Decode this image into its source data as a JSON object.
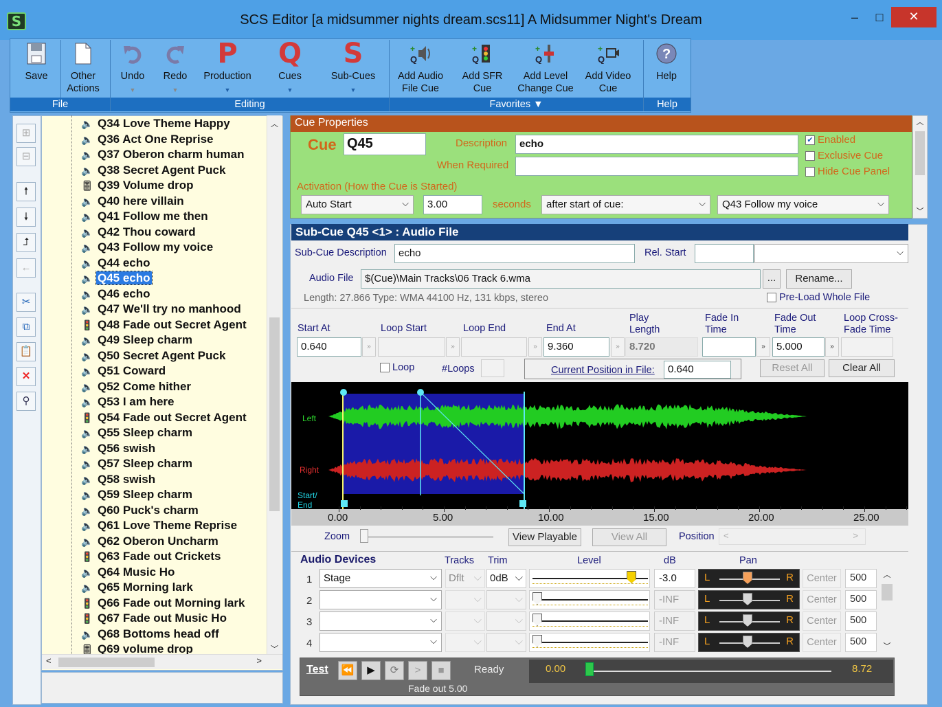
{
  "window": {
    "title": "SCS Editor  [a midsummer nights dream.scs11]  A Midsummer Night's Dream",
    "minimize": "–",
    "maximize": "□",
    "close": "✕"
  },
  "ribbon": {
    "buttons": [
      {
        "id": "save",
        "label": "Save",
        "icon": "save-icon"
      },
      {
        "id": "other",
        "label": "Other Actions",
        "icon": "document-icon"
      },
      {
        "id": "undo",
        "label": "Undo",
        "icon": "undo-icon"
      },
      {
        "id": "redo",
        "label": "Redo",
        "icon": "redo-icon"
      },
      {
        "id": "production",
        "label": "Production",
        "icon": "P"
      },
      {
        "id": "cues",
        "label": "Cues",
        "icon": "Q"
      },
      {
        "id": "subcues",
        "label": "Sub-Cues",
        "icon": "S"
      },
      {
        "id": "add_audio",
        "label": "Add Audio File Cue",
        "icon": "audio-cue-icon"
      },
      {
        "id": "add_sfr",
        "label": "Add SFR Cue",
        "icon": "sfr-cue-icon"
      },
      {
        "id": "add_level",
        "label": "Add Level Change Cue",
        "icon": "level-cue-icon"
      },
      {
        "id": "add_video",
        "label": "Add Video Cue",
        "icon": "video-cue-icon"
      },
      {
        "id": "help",
        "label": "Help",
        "icon": "help-icon"
      }
    ],
    "groups": {
      "file": "File",
      "editing": "Editing",
      "favorites": "Favorites ▼",
      "help": "Help"
    }
  },
  "tree": {
    "items": [
      {
        "label": "Q34 Love Theme Happy",
        "icon": "speaker"
      },
      {
        "label": "Q36 Act One Reprise",
        "icon": "speaker"
      },
      {
        "label": "Q37 Oberon charm human",
        "icon": "speaker"
      },
      {
        "label": "Q38 Secret Agent Puck",
        "icon": "speaker"
      },
      {
        "label": "Q39 Volume drop",
        "icon": "fader"
      },
      {
        "label": "Q40 here villain",
        "icon": "speaker"
      },
      {
        "label": "Q41 Follow me then",
        "icon": "speaker"
      },
      {
        "label": "Q42 Thou coward",
        "icon": "speaker"
      },
      {
        "label": "Q43 Follow my voice",
        "icon": "speaker"
      },
      {
        "label": "Q44 echo",
        "icon": "speaker"
      },
      {
        "label": "Q45 echo",
        "icon": "speaker",
        "selected": true
      },
      {
        "label": "Q46 echo",
        "icon": "speaker"
      },
      {
        "label": "Q47 We'll try no manhood",
        "icon": "speaker"
      },
      {
        "label": "Q48 Fade out Secret Agent",
        "icon": "traffic"
      },
      {
        "label": "Q49 Sleep charm",
        "icon": "speaker"
      },
      {
        "label": "Q50 Secret Agent Puck",
        "icon": "speaker"
      },
      {
        "label": "Q51 Coward",
        "icon": "speaker"
      },
      {
        "label": "Q52 Come hither",
        "icon": "speaker"
      },
      {
        "label": "Q53 I am here",
        "icon": "speaker"
      },
      {
        "label": "Q54 Fade out Secret Agent",
        "icon": "traffic"
      },
      {
        "label": "Q55 Sleep charm",
        "icon": "speaker"
      },
      {
        "label": "Q56 swish",
        "icon": "speaker"
      },
      {
        "label": "Q57 Sleep charm",
        "icon": "speaker"
      },
      {
        "label": "Q58 swish",
        "icon": "speaker"
      },
      {
        "label": "Q59 Sleep charm",
        "icon": "speaker"
      },
      {
        "label": "Q60 Puck's charm",
        "icon": "speaker"
      },
      {
        "label": "Q61 Love Theme Reprise",
        "icon": "speaker"
      },
      {
        "label": "Q62 Oberon Uncharm",
        "icon": "speaker"
      },
      {
        "label": "Q63 Fade out Crickets",
        "icon": "traffic"
      },
      {
        "label": "Q64 Music Ho",
        "icon": "speaker"
      },
      {
        "label": "Q65 Morning lark",
        "icon": "speaker"
      },
      {
        "label": "Q66 Fade out Morning lark",
        "icon": "traffic"
      },
      {
        "label": "Q67 Fade out Music Ho",
        "icon": "traffic"
      },
      {
        "label": "Q68 Bottoms head off",
        "icon": "speaker"
      },
      {
        "label": "Q69 volume drop",
        "icon": "fader"
      }
    ]
  },
  "cue_props": {
    "header": "Cue Properties",
    "cue_label": "Cue",
    "cue_value": "Q45",
    "desc_label": "Description",
    "desc_value": "echo",
    "when_label": "When Required",
    "when_value": "",
    "enabled": "Enabled",
    "exclusive": "Exclusive Cue",
    "hide": "Hide Cue Panel",
    "activation_label": "Activation (How the Cue is Started)",
    "activation_value": "Auto Start",
    "secs_value": "3.00",
    "seconds_label": "seconds",
    "after_value": "after start of cue:",
    "cue_ref_value": "Q43  Follow my voice"
  },
  "subcue": {
    "header": "Sub-Cue Q45 <1> : Audio File",
    "desc_label": "Sub-Cue Description",
    "desc_value": "echo",
    "rel_start_label": "Rel. Start",
    "rel_start_value": "",
    "file_label": "Audio File",
    "file_value": "$(Cue)\\Main Tracks\\06 Track 6.wma",
    "browse": "...",
    "rename": "Rename...",
    "info": "Length: 27.866  Type: WMA 44100 Hz, 131 kbps, stereo",
    "preload": "Pre-Load Whole File",
    "start_at": "Start At",
    "loop_start": "Loop Start",
    "loop_end": "Loop End",
    "end_at": "End At",
    "play_len": "Play Length",
    "fade_in": "Fade In Time",
    "fade_out": "Fade Out Time",
    "loop_xfade": "Loop Cross-Fade Time",
    "start_val": "0.640",
    "end_val": "9.360",
    "play_val": "8.720",
    "fade_out_val": "5.000",
    "loop": "Loop",
    "loops": "#Loops",
    "cur_pos_label": "Current Position in File:",
    "cur_pos_val": "0.640",
    "reset_all": "Reset All",
    "clear_all": "Clear All",
    "wave_left": "Left",
    "wave_right": "Right",
    "wave_startend": "Start/ End",
    "ticks": [
      "0.00",
      "5.00",
      "10.00",
      "15.00",
      "20.00",
      "25.00"
    ],
    "zoom": "Zoom",
    "view_playable": "View Playable",
    "view_all": "View All",
    "position": "Position"
  },
  "devices": {
    "header": "Audio Devices",
    "tracks": "Tracks",
    "trim": "Trim",
    "level": "Level",
    "db": "dB",
    "pan": "Pan",
    "rows": [
      {
        "n": "1",
        "device": "Stage",
        "tracks": "Dflt",
        "trim": "0dB",
        "db": "-3.0",
        "center": "Center",
        "val": "500"
      },
      {
        "n": "2",
        "device": "",
        "tracks": "",
        "trim": "",
        "db": "-INF",
        "center": "Center",
        "val": "500"
      },
      {
        "n": "3",
        "device": "",
        "tracks": "",
        "trim": "",
        "db": "-INF",
        "center": "Center",
        "val": "500"
      },
      {
        "n": "4",
        "device": "",
        "tracks": "",
        "trim": "",
        "db": "-INF",
        "center": "Center",
        "val": "500"
      }
    ],
    "pan_l": "L",
    "pan_r": "R"
  },
  "test": {
    "label": "Test",
    "status": "Ready",
    "pos": "0.00",
    "end": "8.72",
    "fade": "Fade out 5.00"
  }
}
